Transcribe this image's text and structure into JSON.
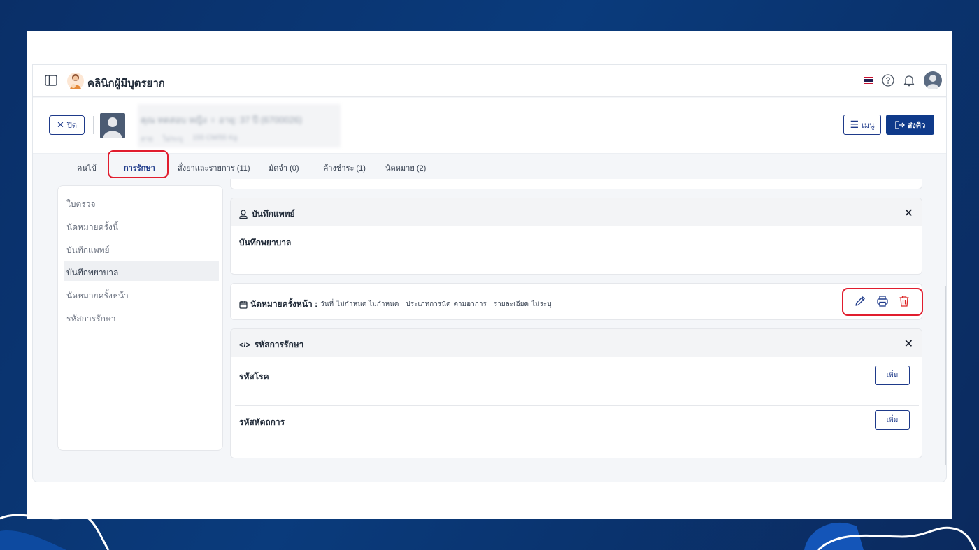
{
  "app": {
    "title": "คลินิกผู้มีบุตรยาก"
  },
  "header_icons": {
    "flag": "thai-flag-icon",
    "help": "help-icon",
    "bell": "bell-icon",
    "avatar": "user-avatar"
  },
  "patient": {
    "close_label": "ปิด",
    "name": "คุณ ทดสอบ หญิง  ♀  อายุ: 37 ปี (6700026)",
    "sub": [
      "ลาย",
      "ไม่ระบุ",
      "155 CM/55 Kg"
    ],
    "menu_label": "เมนู",
    "send_label": "ส่งคิว"
  },
  "tabs": [
    "คนไข้",
    "การรักษา",
    "สั่งยาและรายการ (11)",
    "มัดจำ (0)",
    "ค้างชำระ (1)",
    "นัดหมาย (2)"
  ],
  "active_tab": "การรักษา",
  "leftnav": [
    "ใบตรวจ",
    "นัดหมายครั้งนี้",
    "บันทึกแพทย์",
    "บันทึกพยาบาล",
    "นัดหมายครั้งหน้า",
    "รหัสการรักษา"
  ],
  "leftnav_active": "บันทึกพยาบาล",
  "doctor_note": {
    "title": "บันทึกแพทย์",
    "body": "บันทึกพยาบาล"
  },
  "next_appointment": {
    "label": "นัดหมายครั้งหน้า :",
    "date_label": "วันที่",
    "date_value": "ไม่กำหนด ไม่กำหนด",
    "type_label": "ประเภทการนัด",
    "type_value": "ตามอาการ",
    "detail_label": "รายละเอียด",
    "detail_value": "ไม่ระบุ"
  },
  "treatment_codes": {
    "title": "รหัสการรักษา",
    "rows": [
      {
        "label": "รหัสโรค",
        "button": "เพิ่ม"
      },
      {
        "label": "รหัสหัตถการ",
        "button": "เพิ่ม"
      }
    ]
  },
  "colors": {
    "brand": "#0f3a8a",
    "highlight": "#e11d2e",
    "background": "#0a3b7c"
  }
}
